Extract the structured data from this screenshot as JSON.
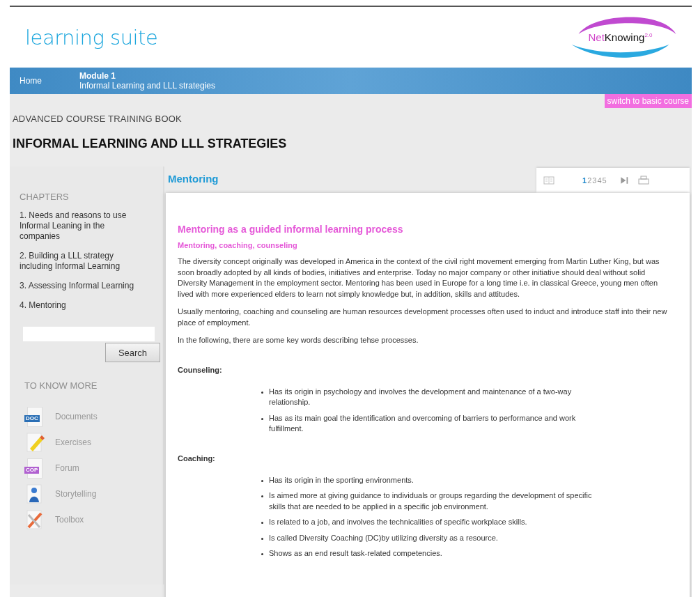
{
  "header": {
    "title": "learning suite",
    "logo": {
      "prefix": "Net",
      "name": "Knowing",
      "version": "2.0"
    }
  },
  "nav": {
    "home": "Home",
    "module": "Module 1",
    "module_title": "Informal Learning and LLL strategies"
  },
  "switch_button": "switch to basic course",
  "book_label": "ADVANCED COURSE TRAINING BOOK",
  "book_title": "INFORMAL LEARNING AND LLL STRATEGIES",
  "sidebar": {
    "chapters_heading": "CHAPTERS",
    "chapters": [
      {
        "label": "1. Needs and reasons to use Informal Leaning in the companies",
        "selected": false
      },
      {
        "label": "2. Building a LLL strategy including Informal Learning",
        "selected": false
      },
      {
        "label": "3. Assessing Informal Learning",
        "selected": false
      },
      {
        "label": "4. Mentoring",
        "selected": false
      }
    ],
    "search_button": "Search",
    "more_heading": "TO KNOW MORE",
    "links": [
      {
        "kind": "doc",
        "badge": "DOC",
        "label": "Documents"
      },
      {
        "kind": "exercise",
        "label": "Exercises"
      },
      {
        "kind": "forum",
        "badge": "COP",
        "label": "Forum"
      },
      {
        "kind": "person",
        "label": "Storytelling"
      },
      {
        "kind": "tools",
        "label": "Toolbox"
      }
    ]
  },
  "section_title": "Mentoring",
  "pages": [
    {
      "label": "1",
      "selected": true
    },
    {
      "label": "2",
      "selected": false
    },
    {
      "label": "3",
      "selected": false
    },
    {
      "label": "4",
      "selected": false
    },
    {
      "label": "5",
      "selected": false
    }
  ],
  "article": {
    "title": "Mentoring as a guided informal learning process",
    "subtitle": "Mentoring, coaching, counseling",
    "paragraphs": [
      "The diversity concept originally was developed in America in the context of the civil right movement emerging from Martin Luther King, but was soon broadly adopted by all kinds of bodies, initiatives and enterprise. Today no major company or other initiative should deal without solid Diversity Management in the employment sector. Mentoring has been used in Europe for a long time i.e. in classical Greece, young men often lived with more experienced elders to learn not simply knowledge but, in addition, skills and attitudes.",
      "Usually mentoring, coaching and counseling are human resources development processes often used to induct and introduce staff into their new place of employment.",
      "In the following, there are some key words describing tehse processes."
    ],
    "sections": [
      {
        "heading": "Counseling:",
        "bullets": [
          "Has its origin in psychology and involves the development and maintenance of a two-way relationship.",
          "Has as its main goal the identification and overcoming of barriers to performance and work fulfillment."
        ]
      },
      {
        "heading": "Coaching:",
        "bullets": [
          "Has its origin in the sporting environments.",
          "Is aimed more at giving guidance to individuals or groups regarding the development of specific skills that are needed to be applied in a specific job environment.",
          "Is related to a job, and involves the technicalities of specific workplace skills.",
          "Is called Diversity Coaching (DC)by utilizing diversity as a resource.",
          "Shows as an end result task-related competencies."
        ]
      }
    ]
  }
}
